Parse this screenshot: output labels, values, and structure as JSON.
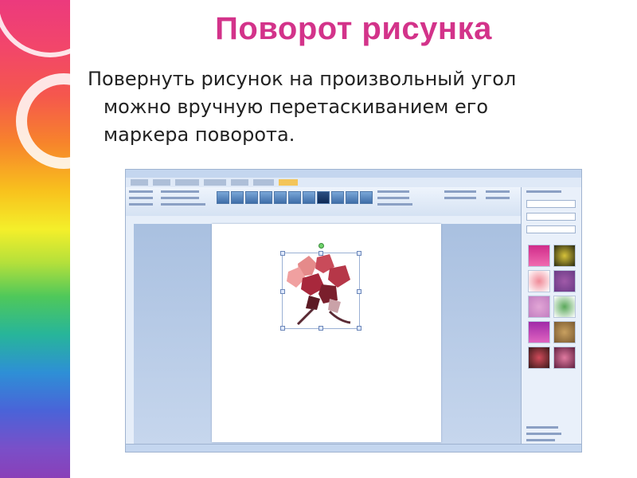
{
  "slide": {
    "title": "Поворот рисунка",
    "body_lines": [
      "Повернуть рисунок на произвольный угол",
      "можно вручную перетаскиванием его",
      "маркера поворота."
    ]
  },
  "colors": {
    "title": "#d3338a",
    "body_text": "#222222",
    "screenshot_background": "#d6e3f4",
    "page": "#ffffff"
  },
  "screenshot": {
    "app_icons": [
      "rotation-handle-icon",
      "flower-clipart-icon"
    ]
  }
}
